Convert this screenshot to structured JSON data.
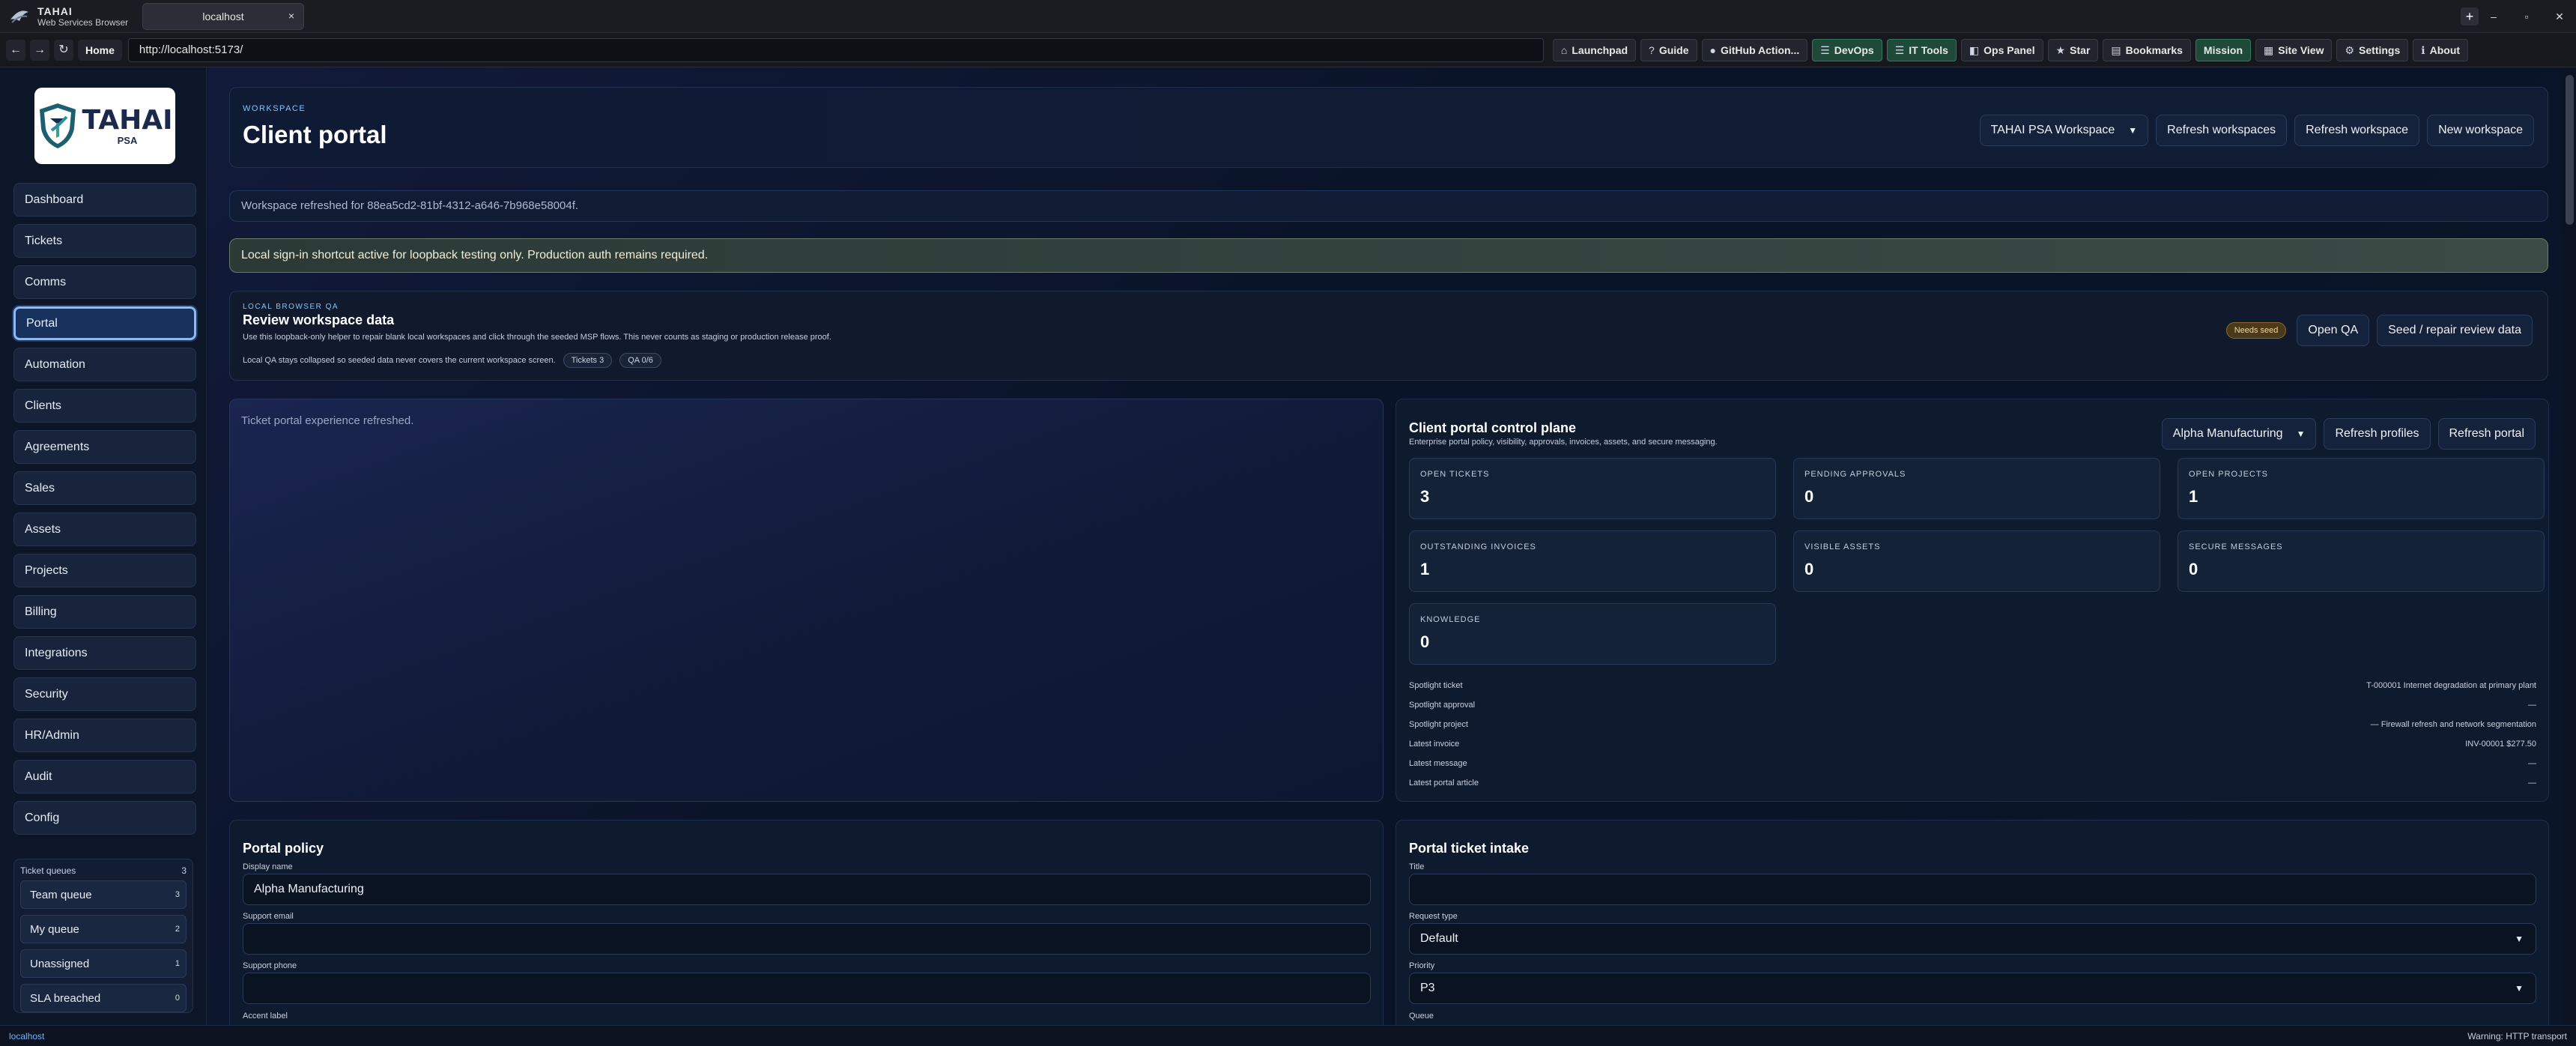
{
  "browser": {
    "brand_title": "TAHAI",
    "brand_subtitle": "Web Services Browser",
    "tab_title": "localhost",
    "tab_close": "×",
    "new_tab": "+",
    "minimize": "–",
    "maximize": "▫",
    "close": "✕",
    "back": "←",
    "forward": "→",
    "reload": "↻",
    "home": "Home",
    "url": "http://localhost:5173/",
    "toolbar": [
      {
        "icon": "⌂",
        "label": "Launchpad",
        "highlight": false
      },
      {
        "icon": "?",
        "label": "Guide",
        "highlight": false
      },
      {
        "icon": "●",
        "label": "GitHub Action...",
        "highlight": false
      },
      {
        "icon": "☰",
        "label": "DevOps",
        "highlight": true
      },
      {
        "icon": "☰",
        "label": "IT Tools",
        "highlight": true
      },
      {
        "icon": "◧",
        "label": "Ops Panel",
        "highlight": false
      },
      {
        "icon": "★",
        "label": "Star",
        "highlight": false
      },
      {
        "icon": "▤",
        "label": "Bookmarks",
        "highlight": false
      },
      {
        "icon": "",
        "label": "Mission",
        "highlight": true
      },
      {
        "icon": "▦",
        "label": "Site View",
        "highlight": false
      },
      {
        "icon": "⚙",
        "label": "Settings",
        "highlight": false
      },
      {
        "icon": "ℹ",
        "label": "About",
        "highlight": false
      }
    ]
  },
  "sidebar": {
    "logo_name": "TAHAI",
    "logo_sub": "PSA",
    "items": [
      {
        "label": "Dashboard",
        "active": false
      },
      {
        "label": "Tickets",
        "active": false
      },
      {
        "label": "Comms",
        "active": false
      },
      {
        "label": "Portal",
        "active": true
      },
      {
        "label": "Automation",
        "active": false
      },
      {
        "label": "Clients",
        "active": false
      },
      {
        "label": "Agreements",
        "active": false
      },
      {
        "label": "Sales",
        "active": false
      },
      {
        "label": "Assets",
        "active": false
      },
      {
        "label": "Projects",
        "active": false
      },
      {
        "label": "Billing",
        "active": false
      },
      {
        "label": "Integrations",
        "active": false
      },
      {
        "label": "Security",
        "active": false
      },
      {
        "label": "HR/Admin",
        "active": false
      },
      {
        "label": "Audit",
        "active": false
      },
      {
        "label": "Config",
        "active": false
      }
    ],
    "queues_title": "Ticket queues",
    "queues_total": "3",
    "queues": [
      {
        "label": "Team queue",
        "count": "3"
      },
      {
        "label": "My queue",
        "count": "2"
      },
      {
        "label": "Unassigned",
        "count": "1"
      },
      {
        "label": "SLA breached",
        "count": "0"
      }
    ]
  },
  "header": {
    "eyebrow": "WORKSPACE",
    "title": "Client portal",
    "workspace_select": "TAHAI PSA Workspace",
    "refresh_workspaces": "Refresh workspaces",
    "refresh_workspace": "Refresh workspace",
    "new_workspace": "New workspace"
  },
  "notices": {
    "refreshed": "Workspace refreshed for 88ea5cd2-81bf-4312-a646-7b968e58004f.",
    "signin": "Local sign-in shortcut active for loopback testing only. Production auth remains required."
  },
  "qa": {
    "eyebrow": "LOCAL BROWSER QA",
    "title": "Review workspace data",
    "desc": "Use this loopback-only helper to repair blank local workspaces and click through the seeded MSP flows. This never counts as staging or production release proof.",
    "note": "Local QA stays collapsed so seeded data never covers the current workspace screen.",
    "chip_tickets": "Tickets 3",
    "chip_qa": "QA 0/6",
    "badge": "Needs seed",
    "open_qa": "Open QA",
    "seed": "Seed / repair review data"
  },
  "left_panel": {
    "message": "Ticket portal experience refreshed."
  },
  "control_plane": {
    "title": "Client portal control plane",
    "subtitle": "Enterprise portal policy, visibility, approvals, invoices, assets, and secure messaging.",
    "client_select": "Alpha Manufacturing",
    "refresh_profiles": "Refresh profiles",
    "refresh_portal": "Refresh portal",
    "stats": [
      {
        "label": "OPEN TICKETS",
        "value": "3"
      },
      {
        "label": "PENDING APPROVALS",
        "value": "0"
      },
      {
        "label": "OPEN PROJECTS",
        "value": "1"
      },
      {
        "label": "OUTSTANDING INVOICES",
        "value": "1"
      },
      {
        "label": "VISIBLE ASSETS",
        "value": "0"
      },
      {
        "label": "SECURE MESSAGES",
        "value": "0"
      },
      {
        "label": "KNOWLEDGE",
        "value": "0"
      }
    ],
    "spotlight": [
      {
        "label": "Spotlight ticket",
        "value": "T-000001 Internet degradation at primary plant"
      },
      {
        "label": "Spotlight approval",
        "value": "—"
      },
      {
        "label": "Spotlight project",
        "value": "— Firewall refresh and network segmentation"
      },
      {
        "label": "Latest invoice",
        "value": "INV-00001 $277.50"
      },
      {
        "label": "Latest message",
        "value": "—"
      },
      {
        "label": "Latest portal article",
        "value": "—"
      }
    ]
  },
  "policy": {
    "title": "Portal policy",
    "display_name_label": "Display name",
    "display_name_value": "Alpha Manufacturing",
    "support_email_label": "Support email",
    "support_email_value": "",
    "support_phone_label": "Support phone",
    "support_phone_value": "",
    "accent_label": "Accent label"
  },
  "intake": {
    "title": "Portal ticket intake",
    "title_label": "Title",
    "title_value": "",
    "request_type_label": "Request type",
    "request_type_value": "Default",
    "priority_label": "Priority",
    "priority_value": "P3",
    "queue_label": "Queue"
  },
  "statusbar": {
    "left": "localhost",
    "right": "Warning: HTTP transport"
  }
}
